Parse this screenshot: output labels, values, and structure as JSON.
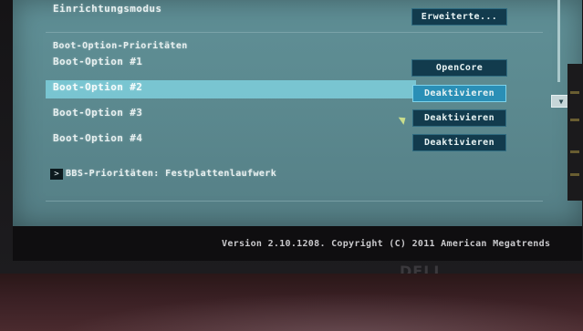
{
  "bios": {
    "mode_label": "Einrichtungsmodus",
    "mode_button": "Erweiterte...",
    "section_title": "Boot-Option-Prioritäten",
    "options": [
      {
        "label": "Boot-Option #1",
        "value": "OpenCore"
      },
      {
        "label": "Boot-Option #2",
        "value": "Deaktivieren"
      },
      {
        "label": "Boot-Option #3",
        "value": "Deaktivieren"
      },
      {
        "label": "Boot-Option #4",
        "value": "Deaktivieren"
      }
    ],
    "submenu_label": "BBS-Prioritäten: Festplattenlaufwerk",
    "submenu_chevron": ">",
    "scroll_arrow": "▼"
  },
  "status": {
    "version": "Version 2.10.1208. Copyright (C) 2011 American Megatrends"
  },
  "monitor": {
    "brand": "DELL"
  },
  "colors": {
    "screen_bg": "#5c8a90",
    "highlight": "#7ccbd8",
    "button_bg": "#123b4d",
    "button_active": "#2a8fb6",
    "text": "#e7f0f0"
  }
}
